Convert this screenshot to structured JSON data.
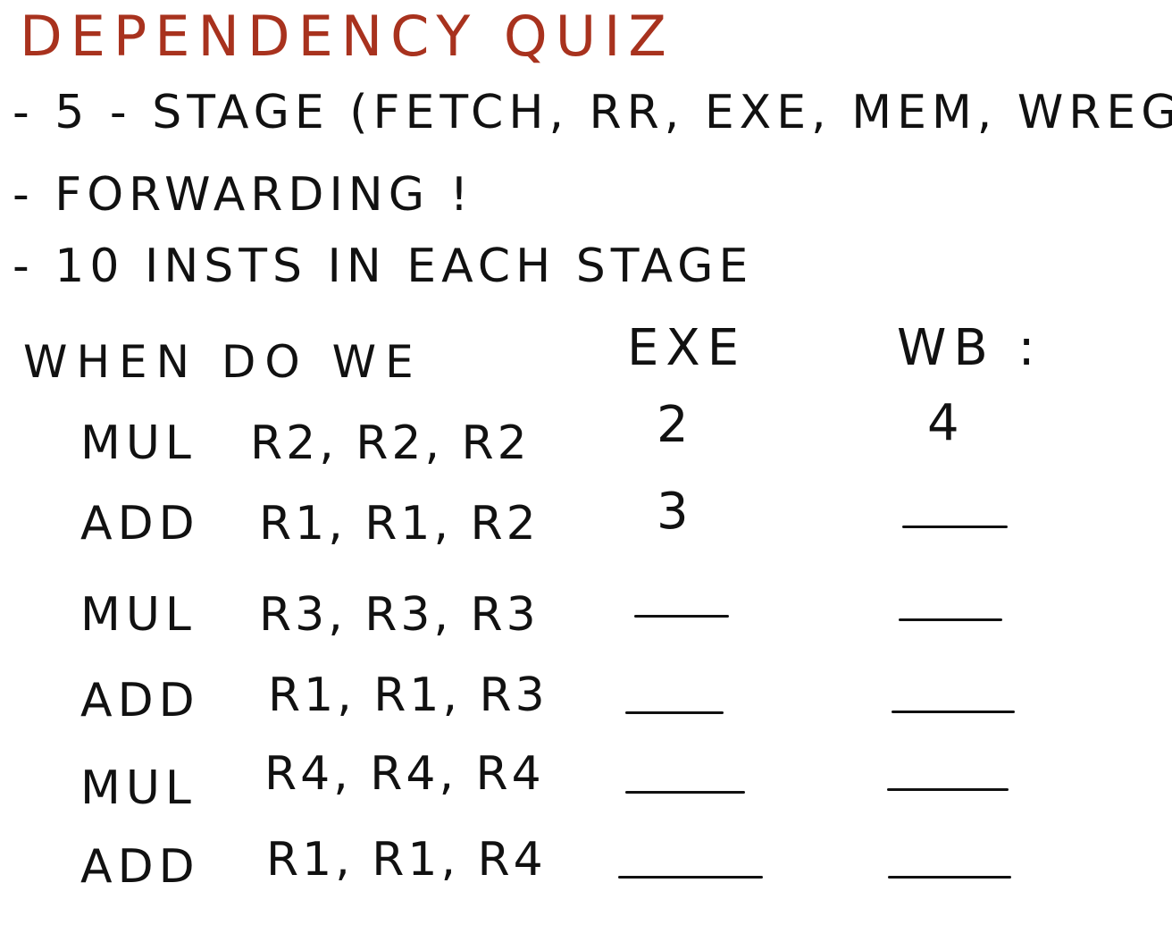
{
  "title": "DEPENDENCY QUIZ",
  "bullets": [
    "- 5 - STAGE (FETCH, RR, EXE, MEM, WREG)",
    "- FORWARDING !",
    "- 10 INSTS IN EACH STAGE"
  ],
  "question": "WHEN DO WE",
  "columns": {
    "exe": "EXE",
    "wb": "WB :"
  },
  "rows": [
    {
      "op": "MUL",
      "args": "R2, R2, R2",
      "exe": "2",
      "wb": "4"
    },
    {
      "op": "ADD",
      "args": "R1, R1, R2",
      "exe": "3",
      "wb": ""
    },
    {
      "op": "MUL",
      "args": "R3, R3, R3",
      "exe": "",
      "wb": ""
    },
    {
      "op": "ADD",
      "args": "R1, R1, R3",
      "exe": "",
      "wb": ""
    },
    {
      "op": "MUL",
      "args": "R4, R4, R4",
      "exe": "",
      "wb": ""
    },
    {
      "op": "ADD",
      "args": "R1, R1, R4",
      "exe": "",
      "wb": ""
    }
  ],
  "colors": {
    "title": "#a8321e",
    "ink": "#111111"
  }
}
